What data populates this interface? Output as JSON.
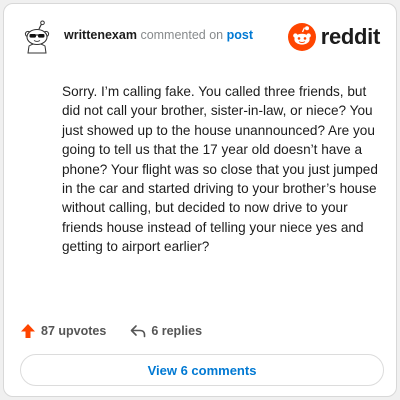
{
  "header": {
    "username": "writtenexam",
    "action_text": "commented on",
    "target_link": "post",
    "brand": "reddit"
  },
  "comment": {
    "text": "Sorry. I’m calling fake. You called three friends, but did not call your brother, sister-in-law, or niece? You just showed up to the house unannounced? Are you going to tell us that the 17 year old doesn’t have a phone? Your flight was so close that you just jumped in the car and started driving to your brother’s house without calling, but decided to now drive to your friends house instead of telling your niece yes and getting to airport earlier?"
  },
  "actions": {
    "upvotes": "87 upvotes",
    "replies": "6 replies"
  },
  "footer": {
    "view_comments": "View 6 comments"
  },
  "colors": {
    "upvote": "#ff4500",
    "link": "#0079d3",
    "brand_orange": "#ff4500"
  }
}
